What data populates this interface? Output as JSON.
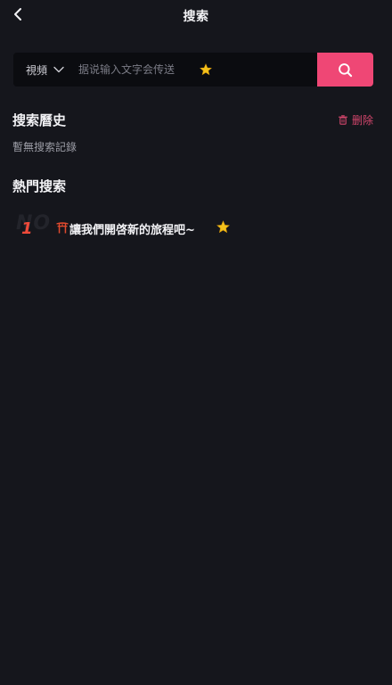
{
  "header": {
    "title": "搜索"
  },
  "search": {
    "category": "視頻",
    "placeholder": "据说输入文字会传送"
  },
  "history": {
    "title": "搜索曆史",
    "delete_label": "删除",
    "empty_text": "暫無搜索記錄"
  },
  "hot": {
    "title": "熱門搜索",
    "items": [
      {
        "rank": "1",
        "rank_watermark": "NO",
        "text": "讓我們開啓新的旅程吧~"
      }
    ]
  },
  "colors": {
    "background": "#15161c",
    "accent": "#ef4775",
    "rank": "#ef4a3a",
    "delete": "#d4466c"
  },
  "icons": {
    "back": "chevron-left-icon",
    "dropdown": "chevron-down-icon",
    "search": "search-icon",
    "trash": "trash-icon",
    "torii": "torii-icon",
    "star": "star-icon"
  }
}
